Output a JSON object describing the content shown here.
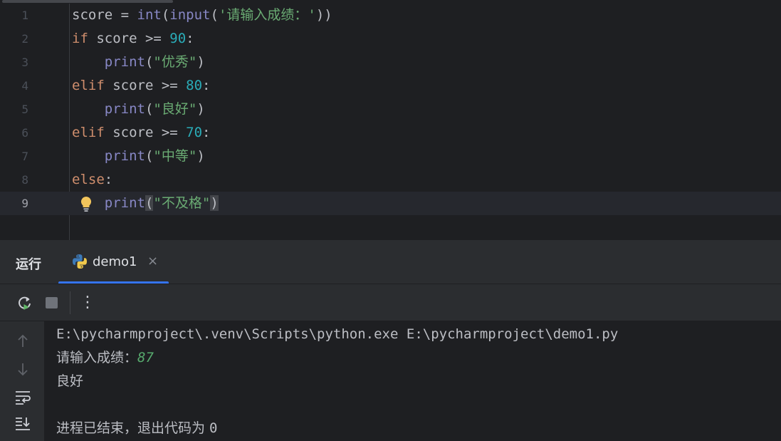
{
  "editor": {
    "lines": [
      {
        "num": "1",
        "parts": [
          {
            "t": "score = ",
            "c": ""
          },
          {
            "t": "int",
            "c": "bi"
          },
          {
            "t": "(",
            "c": ""
          },
          {
            "t": "input",
            "c": "bi"
          },
          {
            "t": "(",
            "c": ""
          },
          {
            "t": "'请输入成绩：'",
            "c": "str"
          },
          {
            "t": "))",
            "c": ""
          }
        ]
      },
      {
        "num": "2",
        "parts": [
          {
            "t": "if",
            "c": "kw"
          },
          {
            "t": " score >= ",
            "c": ""
          },
          {
            "t": "90",
            "c": "num"
          },
          {
            "t": ":",
            "c": ""
          }
        ]
      },
      {
        "num": "3",
        "parts": [
          {
            "t": "    ",
            "c": ""
          },
          {
            "t": "print",
            "c": "bi"
          },
          {
            "t": "(",
            "c": ""
          },
          {
            "t": "\"优秀\"",
            "c": "str"
          },
          {
            "t": ")",
            "c": ""
          }
        ]
      },
      {
        "num": "4",
        "parts": [
          {
            "t": "elif",
            "c": "kw"
          },
          {
            "t": " score >= ",
            "c": ""
          },
          {
            "t": "80",
            "c": "num"
          },
          {
            "t": ":",
            "c": ""
          }
        ]
      },
      {
        "num": "5",
        "parts": [
          {
            "t": "    ",
            "c": ""
          },
          {
            "t": "print",
            "c": "bi"
          },
          {
            "t": "(",
            "c": ""
          },
          {
            "t": "\"良好\"",
            "c": "str"
          },
          {
            "t": ")",
            "c": ""
          }
        ]
      },
      {
        "num": "6",
        "parts": [
          {
            "t": "elif",
            "c": "kw"
          },
          {
            "t": " score >= ",
            "c": ""
          },
          {
            "t": "70",
            "c": "num"
          },
          {
            "t": ":",
            "c": ""
          }
        ]
      },
      {
        "num": "7",
        "parts": [
          {
            "t": "    ",
            "c": ""
          },
          {
            "t": "print",
            "c": "bi"
          },
          {
            "t": "(",
            "c": ""
          },
          {
            "t": "\"中等\"",
            "c": "str"
          },
          {
            "t": ")",
            "c": ""
          }
        ]
      },
      {
        "num": "8",
        "parts": [
          {
            "t": "else",
            "c": "kw"
          },
          {
            "t": ":",
            "c": ""
          }
        ]
      },
      {
        "num": "9",
        "current": true,
        "parts": [
          {
            "t": "    ",
            "c": ""
          },
          {
            "t": "print",
            "c": "bi"
          },
          {
            "t": "(",
            "c": "paren-hl"
          },
          {
            "t": "\"不及格\"",
            "c": "str"
          },
          {
            "t": ")",
            "c": "paren-hl"
          }
        ]
      }
    ]
  },
  "run_panel": {
    "title": "运行",
    "tab_label": "demo1",
    "tab_close": "×",
    "toolbar": {
      "rerun_icon": "rerun-icon",
      "stop_icon": "stop-icon",
      "more_label": "⋮"
    },
    "side_icons": [
      "scroll-up-icon",
      "scroll-down-icon",
      "soft-wrap-icon",
      "scroll-to-end-icon"
    ]
  },
  "console": {
    "command": "E:\\pycharmproject\\.venv\\Scripts\\python.exe E:\\pycharmproject\\demo1.py",
    "prompt": "请输入成绩：",
    "user_input": "87",
    "result": "良好",
    "exit_message_cn": "进程已结束，退出代码为 ",
    "exit_code": "0"
  },
  "colors": {
    "background": "#1e1f22",
    "panel": "#2b2d30",
    "keyword": "#cf8e6d",
    "builtin": "#8888c6",
    "number": "#2aacb8",
    "string": "#6aab73",
    "accent": "#3574f0"
  }
}
